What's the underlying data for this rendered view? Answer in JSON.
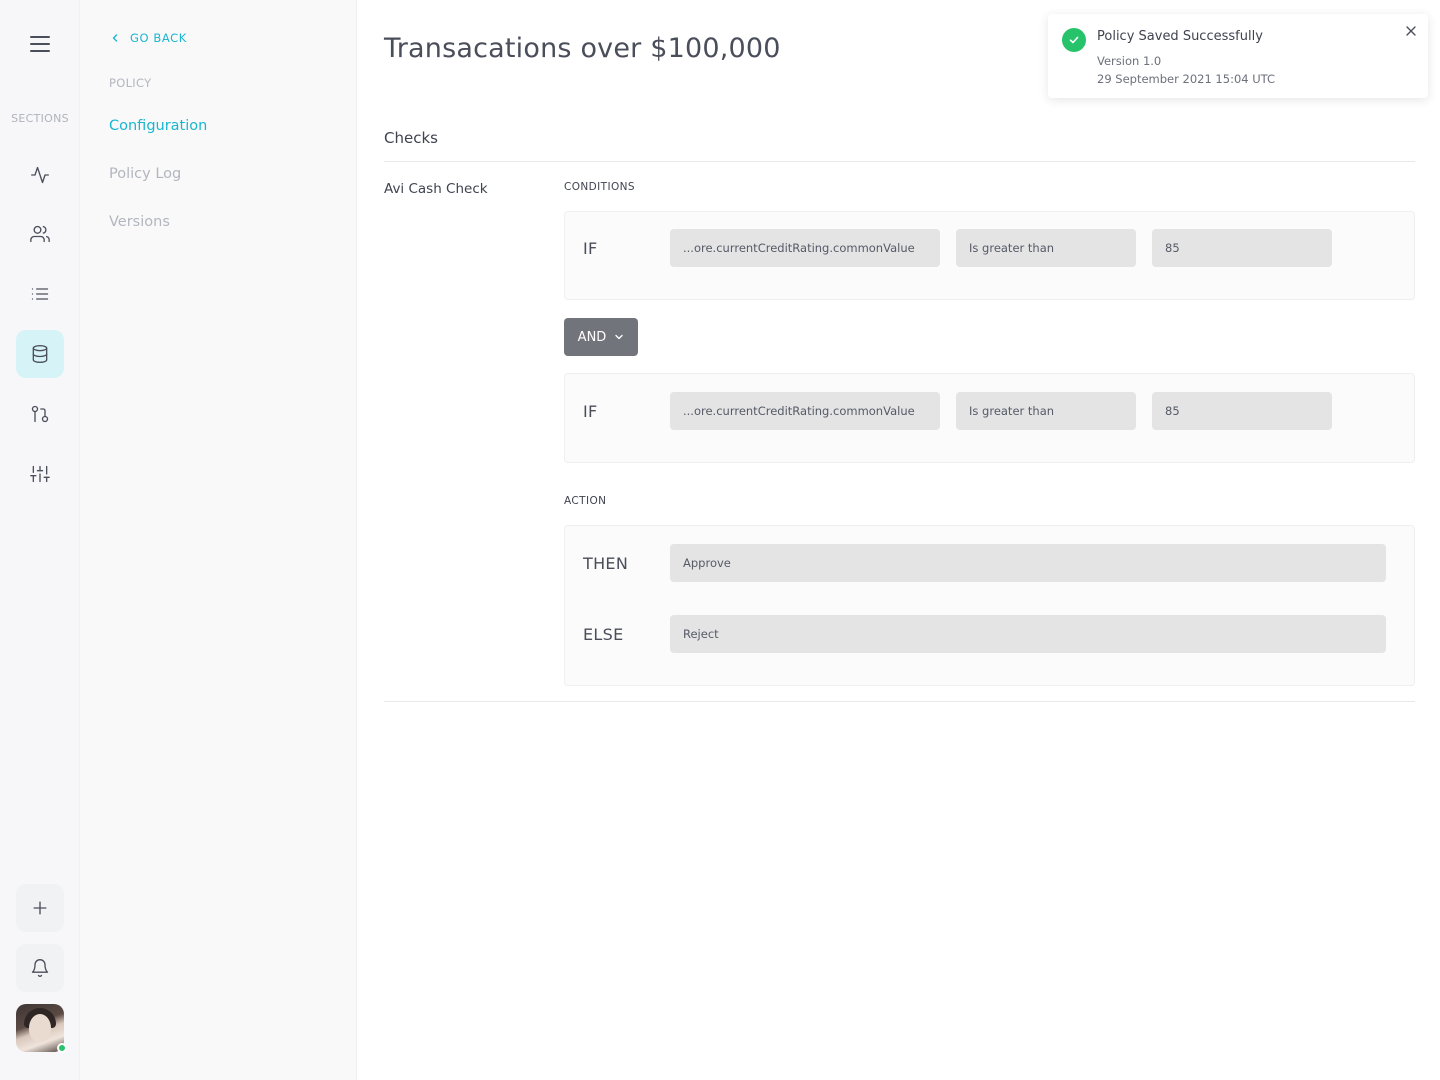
{
  "rail": {
    "sections_label": "SECTIONS",
    "icons": [
      "menu-icon",
      "activity-icon",
      "users-icon",
      "list-icon",
      "database-icon",
      "git-pull-request-icon",
      "sliders-icon",
      "plus-icon",
      "bell-icon"
    ],
    "active_icon": "database-icon",
    "accent_color": "#1ab6cf",
    "active_bg": "#d6f3f7",
    "status_color": "#27c36a"
  },
  "subnav": {
    "go_back": "GO BACK",
    "heading": "POLICY",
    "items": [
      {
        "label": "Configuration",
        "active": true
      },
      {
        "label": "Policy Log",
        "active": false
      },
      {
        "label": "Versions",
        "active": false
      }
    ]
  },
  "main": {
    "title": "Transacations over $100,000",
    "section_title": "Checks",
    "check": {
      "name": "Avi Cash Check",
      "conditions_label": "CONDITIONS",
      "conditions": [
        {
          "keyword": "IF",
          "field": "...ore.currentCreditRating.commonValue",
          "operator": "Is greater than",
          "value": "85"
        },
        {
          "keyword": "IF",
          "field": "...ore.currentCreditRating.commonValue",
          "operator": "Is greater than",
          "value": "85"
        }
      ],
      "join_operator": "AND",
      "action_label": "ACTION",
      "then_keyword": "THEN",
      "then_value": "Approve",
      "else_keyword": "ELSE",
      "else_value": "Reject"
    }
  },
  "toast": {
    "title": "Policy Saved Successfully",
    "version": "Version 1.0",
    "timestamp": "29 September 2021 15:04 UTC"
  }
}
